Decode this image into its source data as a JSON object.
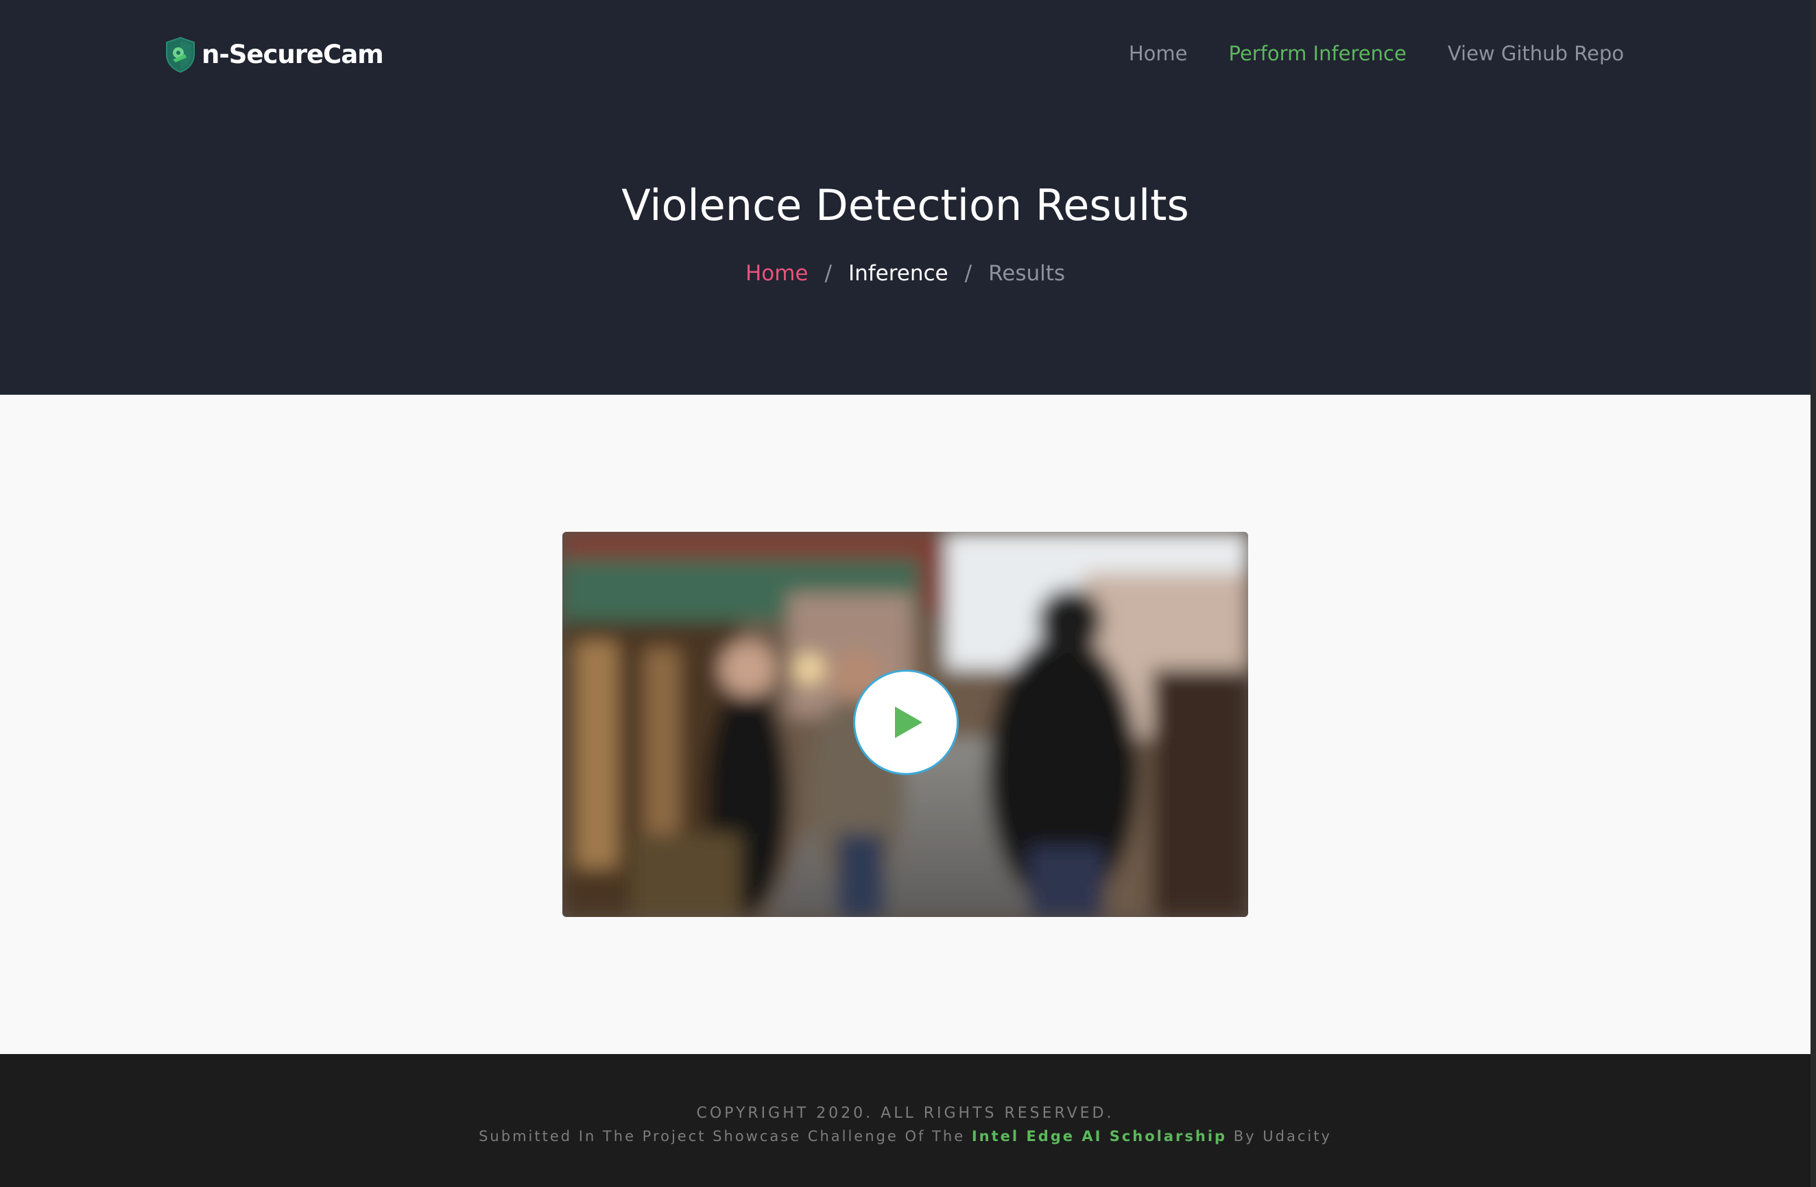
{
  "brand": {
    "name": "n-SecureCam",
    "logo_icon": "shield-camera-icon"
  },
  "nav": {
    "items": [
      {
        "label": "Home",
        "active": false
      },
      {
        "label": "Perform Inference",
        "active": true
      },
      {
        "label": "View Github Repo",
        "active": false
      }
    ]
  },
  "hero": {
    "title": "Violence Detection Results",
    "breadcrumb": {
      "home": "Home",
      "separator": "/",
      "middle": "Inference",
      "current": "Results"
    }
  },
  "video": {
    "play_icon": "play-icon"
  },
  "footer": {
    "copyright": "COPYRIGHT 2020. ALL RIGHTS RESERVED.",
    "credit_prefix": "Submitted In The Project Showcase Challenge Of The",
    "credit_link": "Intel Edge AI Scholarship",
    "credit_suffix": "By Udacity"
  },
  "colors": {
    "header_bg": "#212431",
    "accent_green": "#5cb85c",
    "breadcrumb_home": "#e8537a",
    "footer_bg": "#1c1c1c",
    "content_bg": "#f9f9f9"
  }
}
